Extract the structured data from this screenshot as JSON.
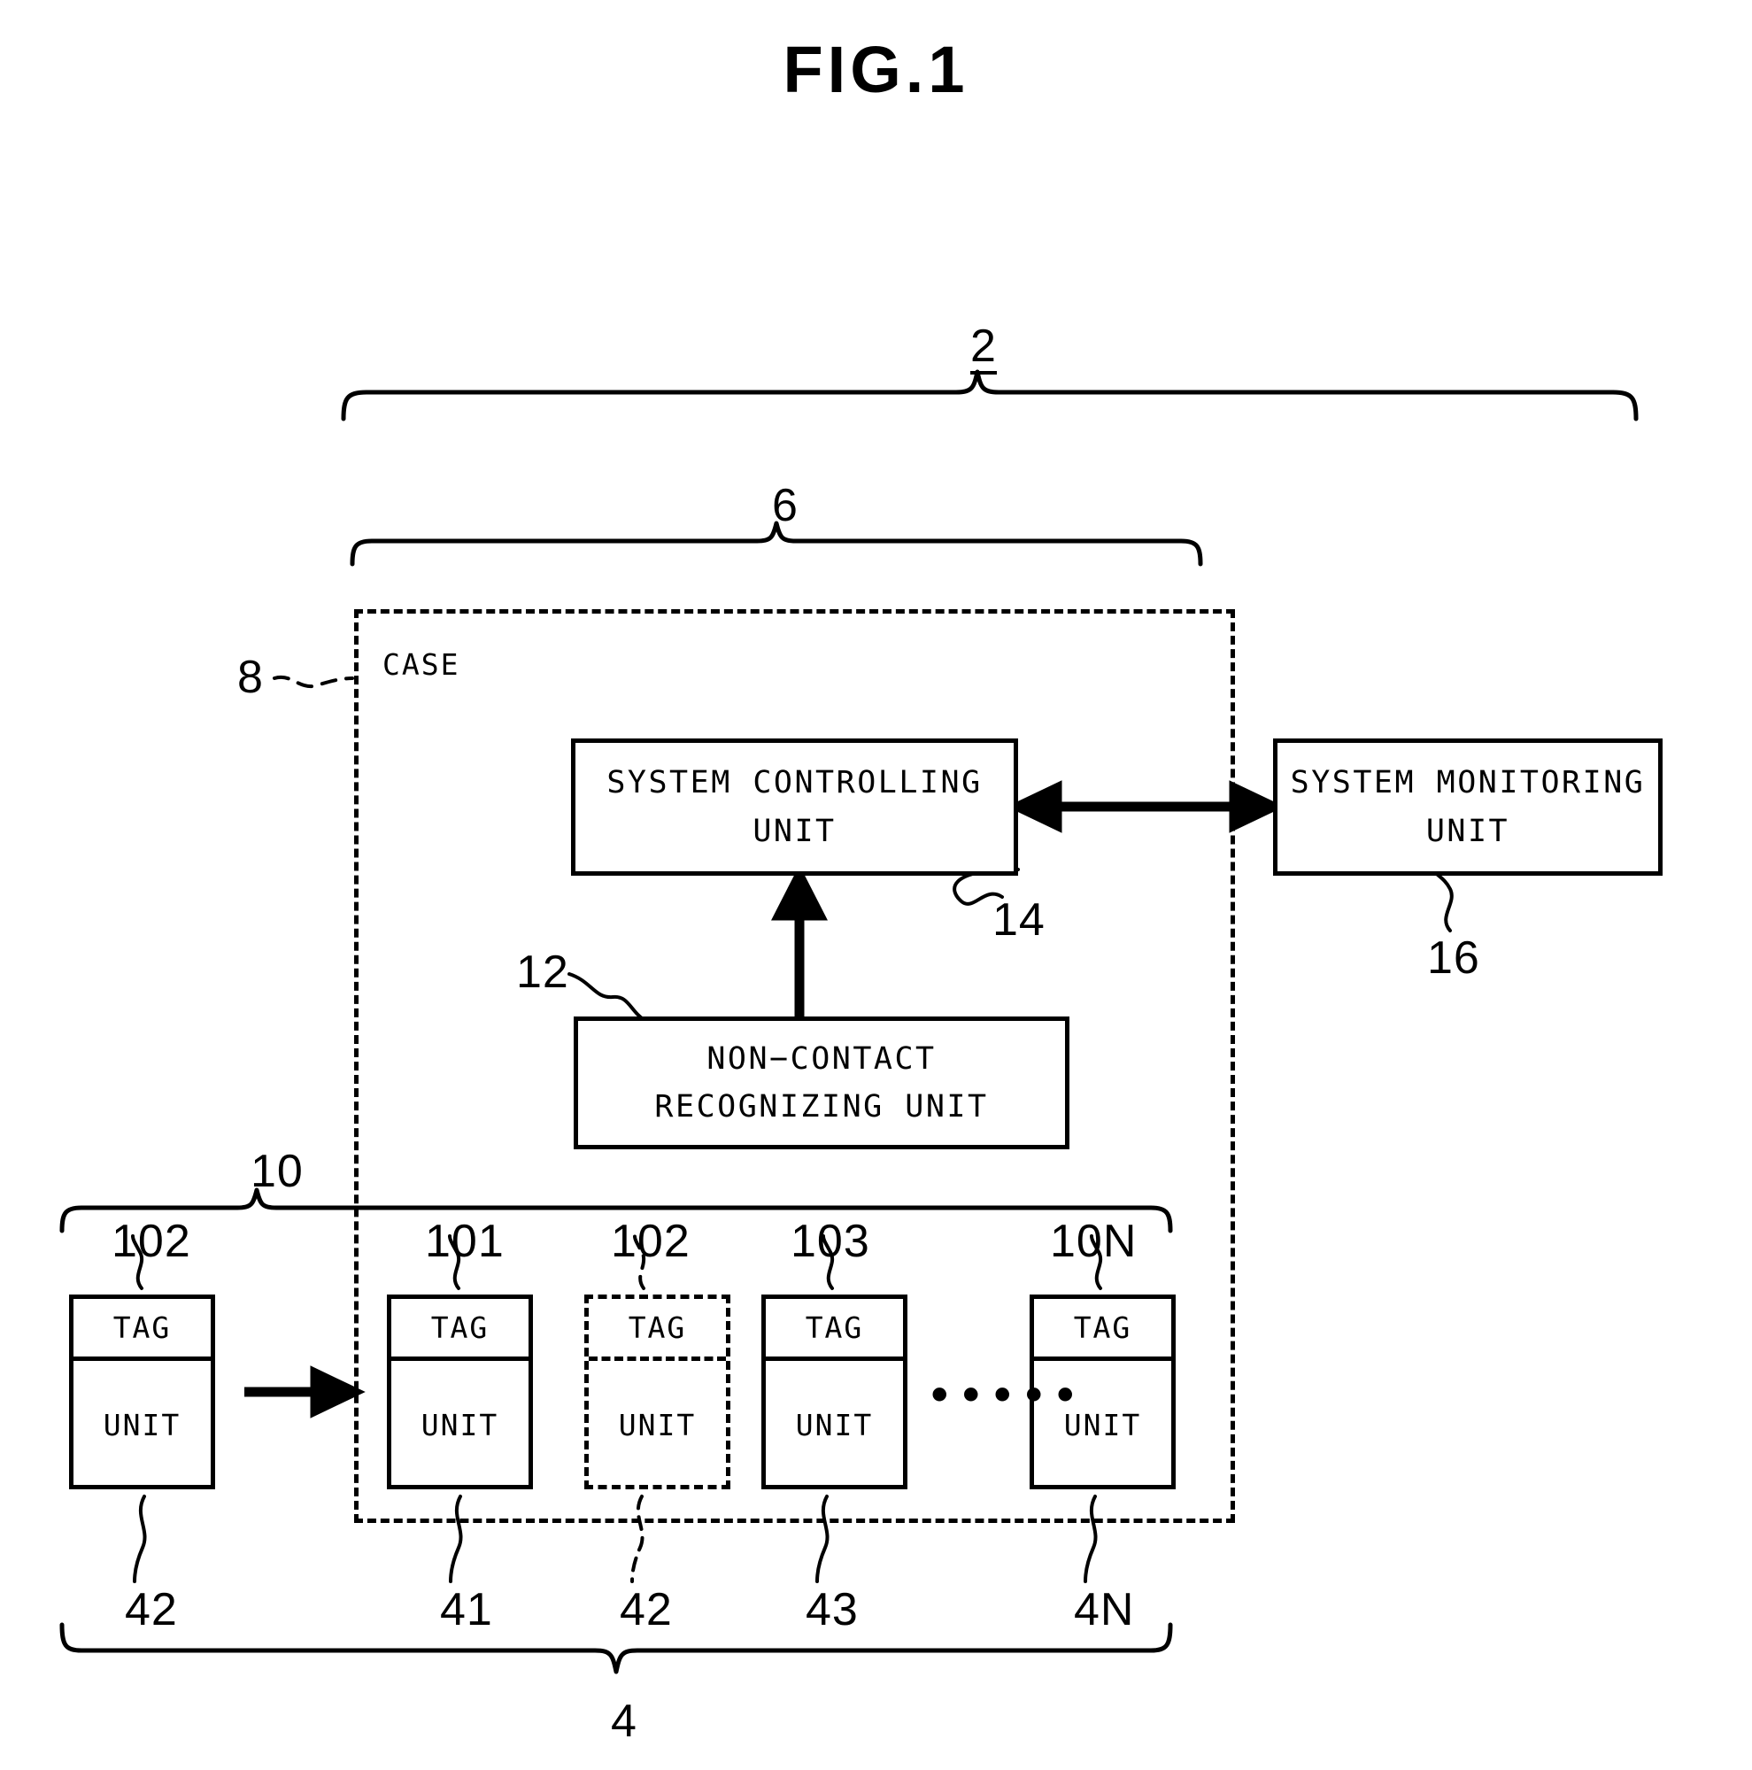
{
  "figure": {
    "title": "FIG.1"
  },
  "case": {
    "label": "CASE",
    "ref": "8"
  },
  "braces": {
    "system_ref": "2",
    "case_assembly_ref": "6",
    "modules_ref": "10",
    "units_ref": "4"
  },
  "blocks": {
    "system_controlling_unit": {
      "label": "SYSTEM CONTROLLING UNIT",
      "ref": "14"
    },
    "system_monitoring_unit": {
      "label": "SYSTEM MONITORING UNIT",
      "ref": "16"
    },
    "non_contact_recognizing_unit": {
      "label": "NON−CONTACT\nRECOGNIZING UNIT",
      "ref": "12"
    }
  },
  "modules": [
    {
      "name": "spare-module",
      "ref": "102",
      "tag": "TAG",
      "unit": "UNIT",
      "style": "solid",
      "unit_ref": "42",
      "inside_case": false
    },
    {
      "name": "module-1",
      "ref": "101",
      "tag": "TAG",
      "unit": "UNIT",
      "style": "solid",
      "unit_ref": "41",
      "inside_case": true
    },
    {
      "name": "module-2-slot",
      "ref": "102",
      "tag": "TAG",
      "unit": "UNIT",
      "style": "dashed",
      "unit_ref": "42",
      "inside_case": true
    },
    {
      "name": "module-3",
      "ref": "103",
      "tag": "TAG",
      "unit": "UNIT",
      "style": "solid",
      "unit_ref": "43",
      "inside_case": true
    },
    {
      "name": "module-n",
      "ref": "10N",
      "tag": "TAG",
      "unit": "UNIT",
      "style": "solid",
      "unit_ref": "4N",
      "inside_case": true
    }
  ],
  "ellipsis": "•••••",
  "colors": {
    "ink": "#000000",
    "paper": "#ffffff"
  }
}
